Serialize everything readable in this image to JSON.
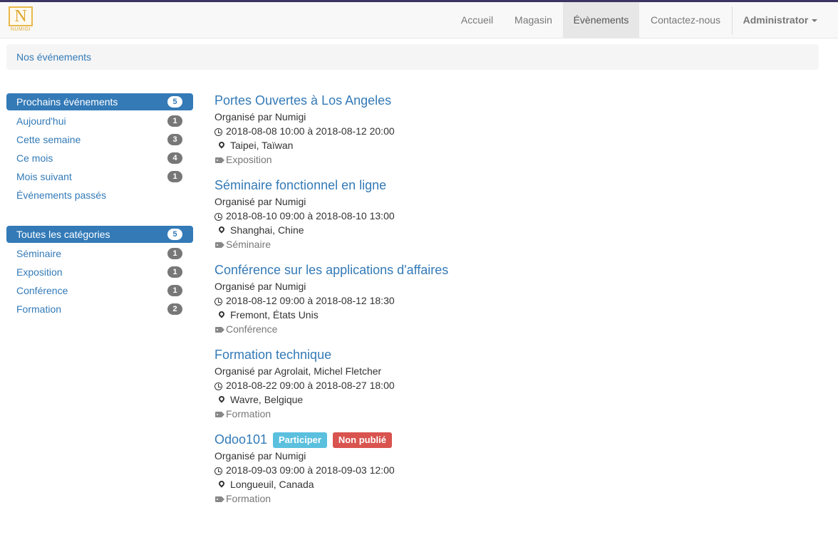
{
  "navbar": {
    "logo_text": "NUMIGI",
    "items": [
      "Accueil",
      "Magasin",
      "Évènements",
      "Contactez-nous"
    ],
    "active_item": "Évènements",
    "user": "Administrator"
  },
  "breadcrumb": {
    "label": "Nos événements"
  },
  "sidebar": {
    "dates": [
      {
        "label": "Prochains événements",
        "count": "5",
        "active": true
      },
      {
        "label": "Aujourd'hui",
        "count": "1"
      },
      {
        "label": "Cette semaine",
        "count": "3"
      },
      {
        "label": "Ce mois",
        "count": "4"
      },
      {
        "label": "Mois suivant",
        "count": "1"
      },
      {
        "label": "Événements passés",
        "count": ""
      }
    ],
    "categories": [
      {
        "label": "Toutes les catégories",
        "count": "5",
        "active": true
      },
      {
        "label": "Séminaire",
        "count": "1"
      },
      {
        "label": "Exposition",
        "count": "1"
      },
      {
        "label": "Conférence",
        "count": "1"
      },
      {
        "label": "Formation",
        "count": "2"
      }
    ]
  },
  "events": [
    {
      "title": "Portes Ouvertes à Los Angeles",
      "organizer": "Organisé par Numigi",
      "dates": "2018-08-08 10:00 à 2018-08-12 20:00",
      "location": "Taipei, Taïwan",
      "tag": "Exposition"
    },
    {
      "title": "Séminaire fonctionnel en ligne",
      "organizer": "Organisé par Numigi",
      "dates": "2018-08-10 09:00 à 2018-08-10 13:00",
      "location": "Shanghai, Chine",
      "tag": "Séminaire"
    },
    {
      "title": "Conférence sur les applications d'affaires",
      "organizer": "Organisé par Numigi",
      "dates": "2018-08-12 09:00 à 2018-08-12 18:30",
      "location": "Fremont, États Unis",
      "tag": "Conférence"
    },
    {
      "title": "Formation technique",
      "organizer": "Organisé par Agrolait, Michel Fletcher",
      "dates": "2018-08-22 09:00 à 2018-08-27 18:00",
      "location": "Wavre, Belgique",
      "tag": "Formation"
    },
    {
      "title": "Odoo101",
      "organizer": "Organisé par Numigi",
      "dates": "2018-09-03 09:00 à 2018-09-03 12:00",
      "location": "Longueuil, Canada",
      "tag": "Formation",
      "badges": [
        "Participer",
        "Non publié"
      ]
    }
  ],
  "colors": {
    "link": "#337ab7",
    "badge_info": "#5bc0de",
    "badge_danger": "#d9534f",
    "logo": "#e0a82e"
  }
}
